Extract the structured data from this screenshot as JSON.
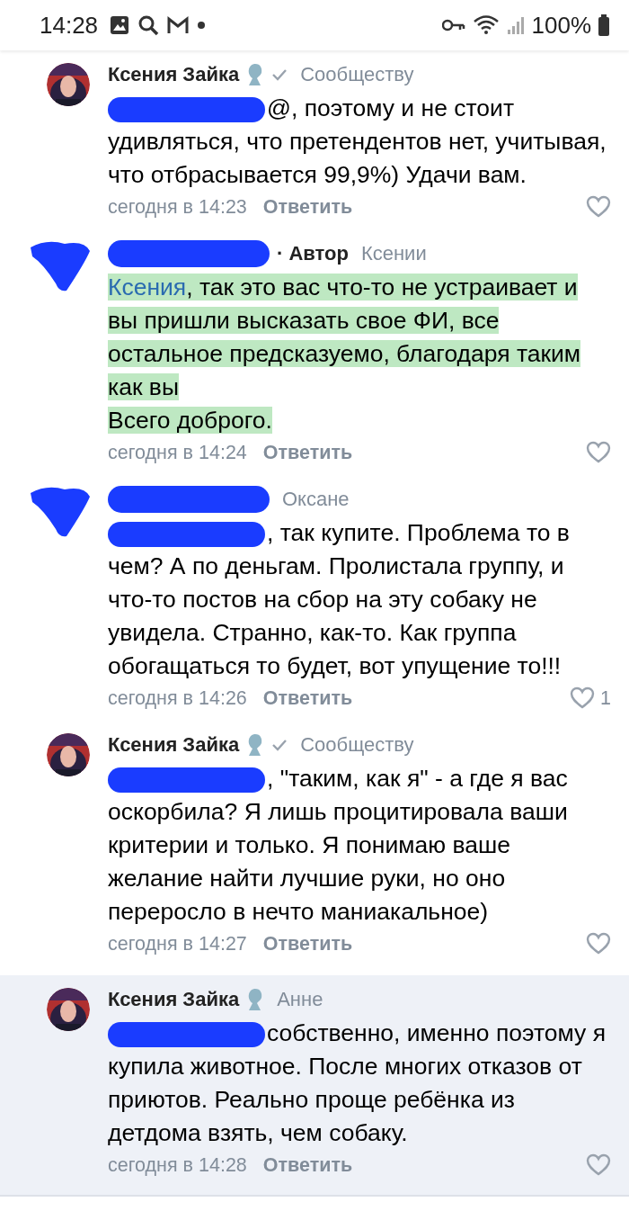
{
  "status_bar": {
    "time": "14:28",
    "battery": "100%"
  },
  "comments": [
    {
      "author": "Ксения Зайка",
      "author_redacted": false,
      "avatar_redacted": false,
      "badge": true,
      "verified": true,
      "reply_to": "Сообществу",
      "mention_redacted": true,
      "body": "@, поэтому и не стоит удивляться, что претендентов нет, учитывая, что отбрасывается 99,9%) Удачи вам.",
      "highlighted": false,
      "time": "сегодня в 14:23",
      "reply": "Ответить",
      "selected": false
    },
    {
      "author_redacted": true,
      "avatar_redacted": true,
      "badge": false,
      "verified": false,
      "role": "· Автор",
      "reply_to": "Ксении",
      "mention": "Ксения",
      "mention_redacted": false,
      "body": ", так это вас что-то не устраивает и вы пришли высказать свое ФИ, все остальное предсказуемо, благодаря таким как вы\nВсего доброго.",
      "highlighted": true,
      "time": "сегодня в 14:24",
      "reply": "Ответить",
      "selected": false
    },
    {
      "author_redacted": true,
      "avatar_redacted": true,
      "badge": false,
      "verified": false,
      "reply_to": "Оксане",
      "mention_redacted": true,
      "body": ", так купите. Проблема то в чем? А по деньгам. Пролистала группу, и что-то постов на сбор на эту собаку не увидела. Странно, как-то. Как группа обогащаться то будет, вот упущение то!!!",
      "highlighted": false,
      "time": "сегодня в 14:26",
      "reply": "Ответить",
      "likes": "1",
      "selected": false
    },
    {
      "author": "Ксения Зайка",
      "author_redacted": false,
      "avatar_redacted": false,
      "badge": true,
      "verified": true,
      "reply_to": "Сообществу",
      "mention_redacted": true,
      "body": ", \"таким, как я\" - а где я вас оскорбила? Я лишь процитировала ваши критерии и только. Я понимаю ваше желание найти лучшие руки, но оно переросло в нечто маниакальное)",
      "highlighted": false,
      "time": "сегодня в 14:27",
      "reply": "Ответить",
      "selected": false
    },
    {
      "author": "Ксения Зайка",
      "author_redacted": false,
      "avatar_redacted": false,
      "badge": true,
      "verified": false,
      "reply_to": "Анне",
      "mention_redacted": true,
      "body": "собственно, именно поэтому я купила животное. После многих отказов от приютов. Реально проще ребёнка из детдома взять, чем собаку.",
      "highlighted": false,
      "time": "сегодня в 14:28",
      "reply": "Ответить",
      "selected": true
    }
  ]
}
